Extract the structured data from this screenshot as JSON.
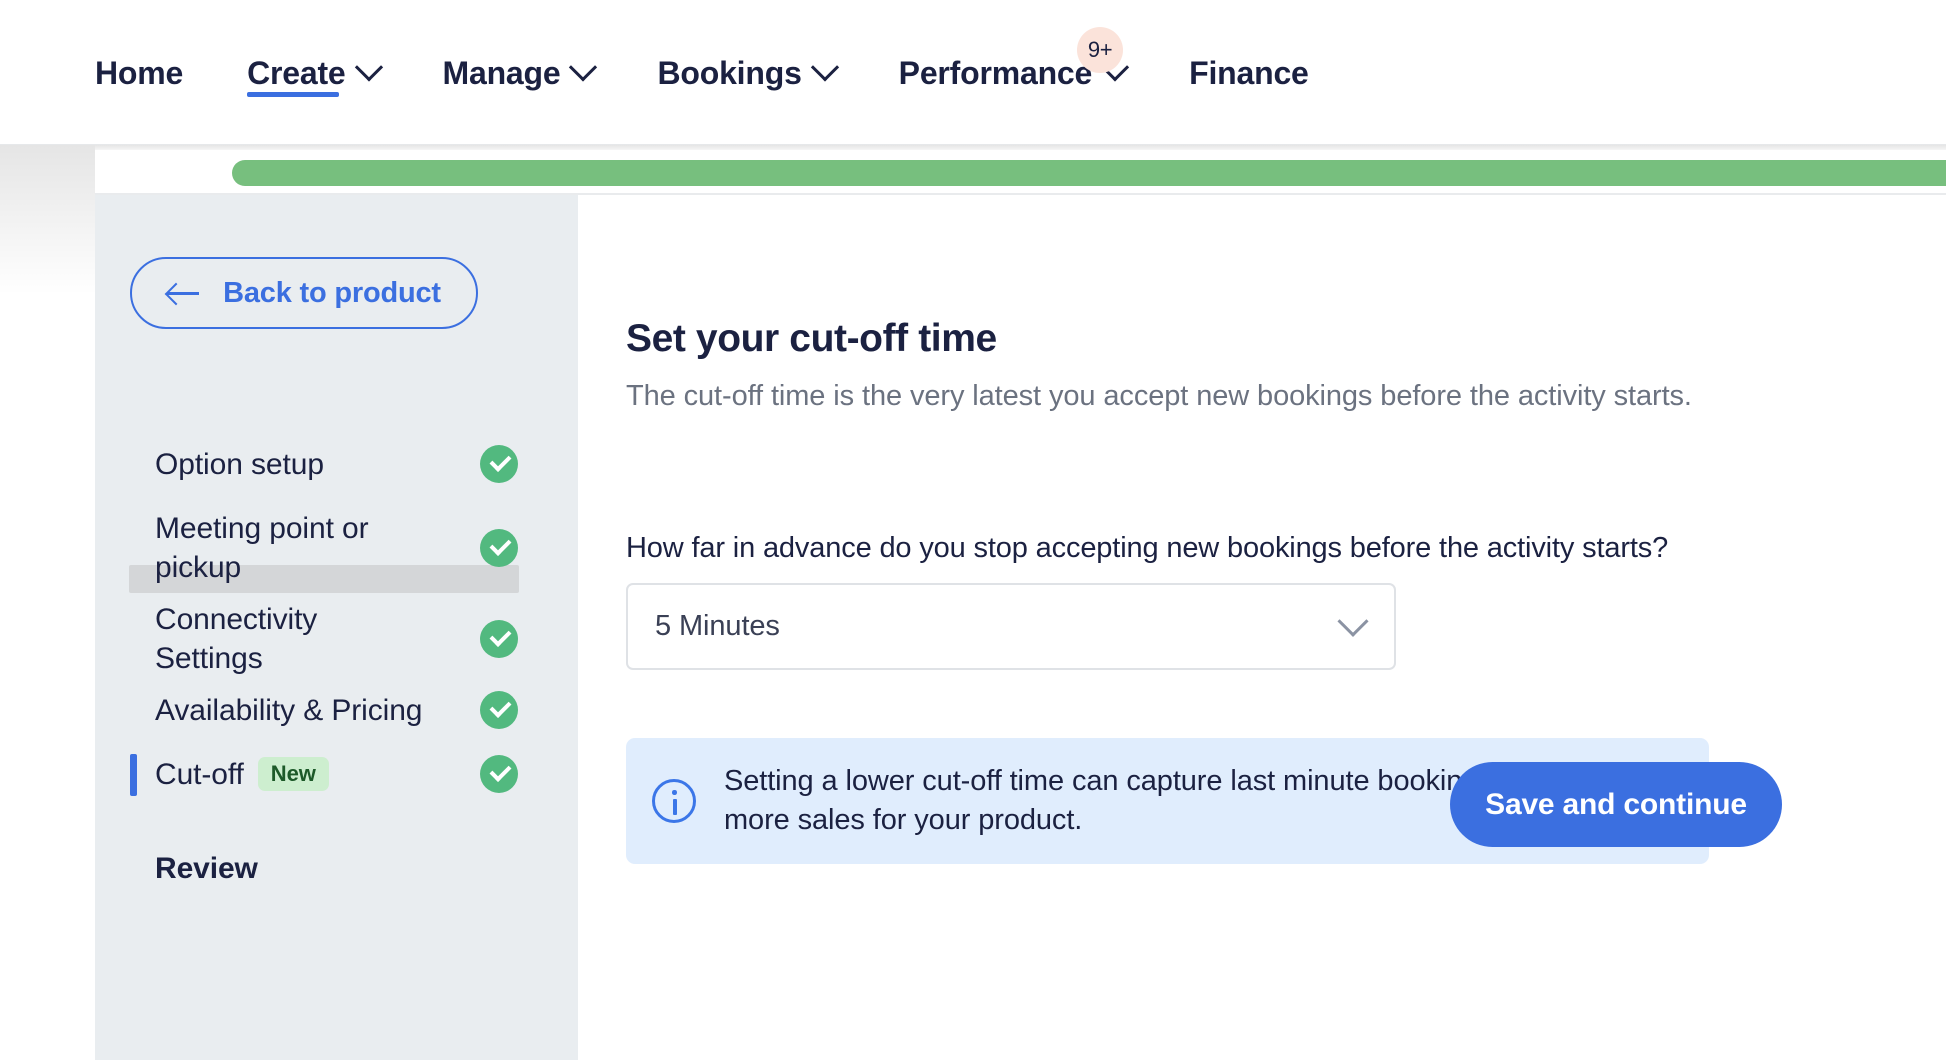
{
  "topnav": {
    "items": [
      {
        "label": "Home",
        "has_caret": false,
        "active": false,
        "badge": ""
      },
      {
        "label": "Create",
        "has_caret": true,
        "active": true,
        "badge": ""
      },
      {
        "label": "Manage",
        "has_caret": true,
        "active": false,
        "badge": ""
      },
      {
        "label": "Bookings",
        "has_caret": true,
        "active": false,
        "badge": ""
      },
      {
        "label": "Performance",
        "has_caret": true,
        "active": false,
        "badge": "9+"
      },
      {
        "label": "Finance",
        "has_caret": false,
        "active": false,
        "badge": ""
      }
    ]
  },
  "progress": {
    "percent": 93,
    "fill_color": "#77bf7e"
  },
  "sidebar": {
    "back_button_label": "Back to product",
    "back_icon": "arrow-left-icon",
    "steps": [
      {
        "label": "Option setup",
        "completed": true,
        "active": false,
        "badge": ""
      },
      {
        "label": "Meeting point or pickup",
        "completed": true,
        "active": false,
        "badge": ""
      },
      {
        "label": "Connectivity Settings",
        "completed": true,
        "active": false,
        "badge": ""
      },
      {
        "label": "Availability & Pricing",
        "completed": true,
        "active": false,
        "badge": ""
      },
      {
        "label": "Cut-off",
        "completed": true,
        "active": true,
        "badge": "New"
      },
      {
        "label": "Review",
        "completed": false,
        "active": false,
        "badge": ""
      }
    ]
  },
  "main": {
    "title": "Set your cut-off time",
    "description": "The cut-off time is the very latest you accept new bookings before the activity starts.",
    "field_label": "How far in advance do you stop accepting new bookings before the activity starts?",
    "select": {
      "value": "5 Minutes",
      "icon": "chevron-down-icon",
      "options": [
        "5 Minutes"
      ]
    },
    "info_banner": {
      "icon": "info-circle-icon",
      "text": "Setting a lower cut-off time can capture last minute bookings and drive more sales for your product.",
      "close_icon": "close-icon"
    },
    "save_button_label": "Save and continue"
  },
  "colors": {
    "accent_blue": "#3b6fe0",
    "navy_text": "#1b2141",
    "sidebar_bg": "#e9edf0",
    "success_green": "#52b97f",
    "progress_green": "#77bf7e",
    "badge_new_bg": "#cdeecf",
    "badge_new_text": "#1d5a29",
    "banner_bg": "#e0edfd",
    "nav_badge_bg": "#fbe3da"
  }
}
